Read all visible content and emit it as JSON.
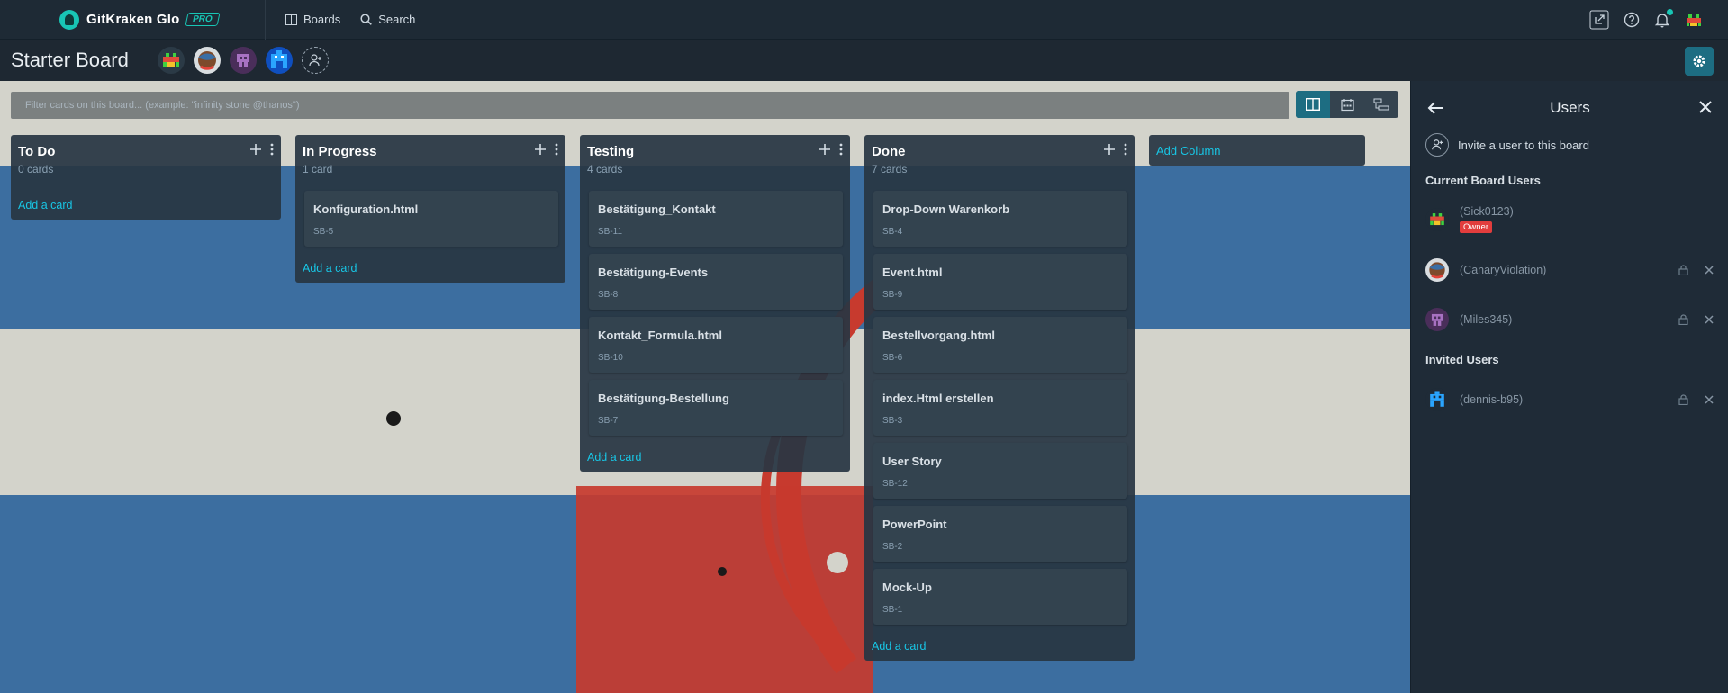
{
  "app": {
    "brand": "GitKraken Glo",
    "badge": "PRO"
  },
  "topnav": {
    "boards": "Boards",
    "search": "Search"
  },
  "board": {
    "title": "Starter Board"
  },
  "filter": {
    "placeholder": "Filter cards on this board... (example: \"infinity stone @thanos\")"
  },
  "columns": [
    {
      "title": "To Do",
      "count": "0 cards",
      "add_card": "Add a card",
      "cards": []
    },
    {
      "title": "In Progress",
      "count": "1 card",
      "add_card": "Add a card",
      "cards": [
        {
          "title": "Konfiguration.html",
          "id": "SB-5"
        }
      ]
    },
    {
      "title": "Testing",
      "count": "4 cards",
      "add_card": "Add a card",
      "cards": [
        {
          "title": "Bestätigung_Kontakt",
          "id": "SB-11"
        },
        {
          "title": "Bestätigung-Events",
          "id": "SB-8"
        },
        {
          "title": "Kontakt_Formula.html",
          "id": "SB-10"
        },
        {
          "title": "Bestätigung-Bestellung",
          "id": "SB-7"
        }
      ]
    },
    {
      "title": "Done",
      "count": "7 cards",
      "add_card": "Add a card",
      "cards": [
        {
          "title": "Drop-Down Warenkorb",
          "id": "SB-4"
        },
        {
          "title": "Event.html",
          "id": "SB-9"
        },
        {
          "title": "Bestellvorgang.html",
          "id": "SB-6"
        },
        {
          "title": "index.Html erstellen",
          "id": "SB-3"
        },
        {
          "title": "User Story",
          "id": "SB-12"
        },
        {
          "title": "PowerPoint",
          "id": "SB-2"
        },
        {
          "title": "Mock-Up",
          "id": "SB-1"
        }
      ]
    }
  ],
  "add_column": "Add Column",
  "users_panel": {
    "title": "Users",
    "invite": "Invite a user to this board",
    "current_heading": "Current Board Users",
    "invited_heading": "Invited Users",
    "current": [
      {
        "name": "(Sick0123)",
        "badge": "Owner"
      },
      {
        "name": "(CanaryViolation)"
      },
      {
        "name": "(Miles345)"
      }
    ],
    "invited": [
      {
        "name": "(dennis-b95)"
      }
    ]
  },
  "colors": {
    "accent": "#18c6e5",
    "teal": "#18c6b5",
    "owner": "#e23d3d"
  }
}
